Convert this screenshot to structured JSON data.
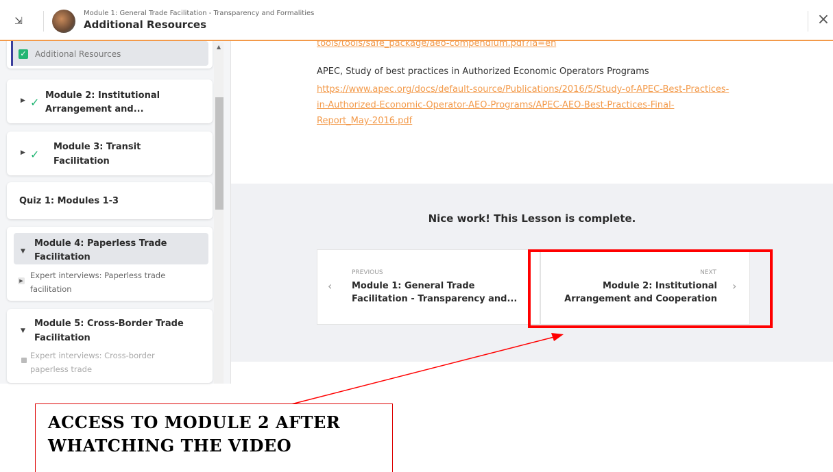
{
  "header": {
    "collapse_icon": "collapse-icon",
    "course_subtitle": "Module 1: General Trade Facilitation - Transparency and Formalities",
    "lesson_title": "Additional Resources",
    "close_icon": "close-icon"
  },
  "sidebar": {
    "active_item": {
      "label": "Additional Resources",
      "check": "✓"
    },
    "modules": [
      {
        "title_l1": "Module 2: Institutional",
        "title_l2": "Arrangement and..."
      },
      {
        "title_l1": "Module 3: Transit",
        "title_l2": "Facilitation"
      },
      {
        "title_l1": "Quiz 1: Modules 1-3"
      },
      {
        "title_l1": "Module 4: Paperless Trade",
        "title_l2": "Facilitation",
        "sub_l1": "Expert interviews: Paperless trade",
        "sub_l2": "facilitation"
      },
      {
        "title_l1": "Module 5: Cross-Border Trade",
        "title_l2": "Facilitation",
        "sub_l1": "Expert interviews: Cross-border",
        "sub_l2": "paperless trade"
      }
    ]
  },
  "content": {
    "top_link_fragment": "tools/tools/safe_package/aeo-compendium.pdf?la=en",
    "resource_text": "APEC, Study of best practices in Authorized Economic Operators Programs",
    "resource_link_l1": "https://www.apec.org/docs/default-source/Publications/2016/5/Study-of-APEC-Best-Practices-",
    "resource_link_l2": "in-Authorized-Economic-Operator-AEO-Programs/APEC-AEO-Best-Practices-Final-",
    "resource_link_l3": "Report_May-2016.pdf",
    "complete_message": "Nice work! This Lesson is complete."
  },
  "nav": {
    "previous": {
      "label": "PREVIOUS",
      "title_l1": "Module 1: General Trade",
      "title_l2": "Facilitation - Transparency and..."
    },
    "next": {
      "label": "NEXT",
      "title_l1": "Module 2: Institutional",
      "title_l2": "Arrangement and Cooperation"
    }
  },
  "annotation": {
    "line1": "ACCESS TO MODULE 2 AFTER",
    "line2": "WHATCHING THE VIDEO"
  },
  "colors": {
    "accent": "#f39a4a",
    "success": "#22b573",
    "annotation": "#ff0000",
    "active_bar": "#3a3e9c"
  }
}
